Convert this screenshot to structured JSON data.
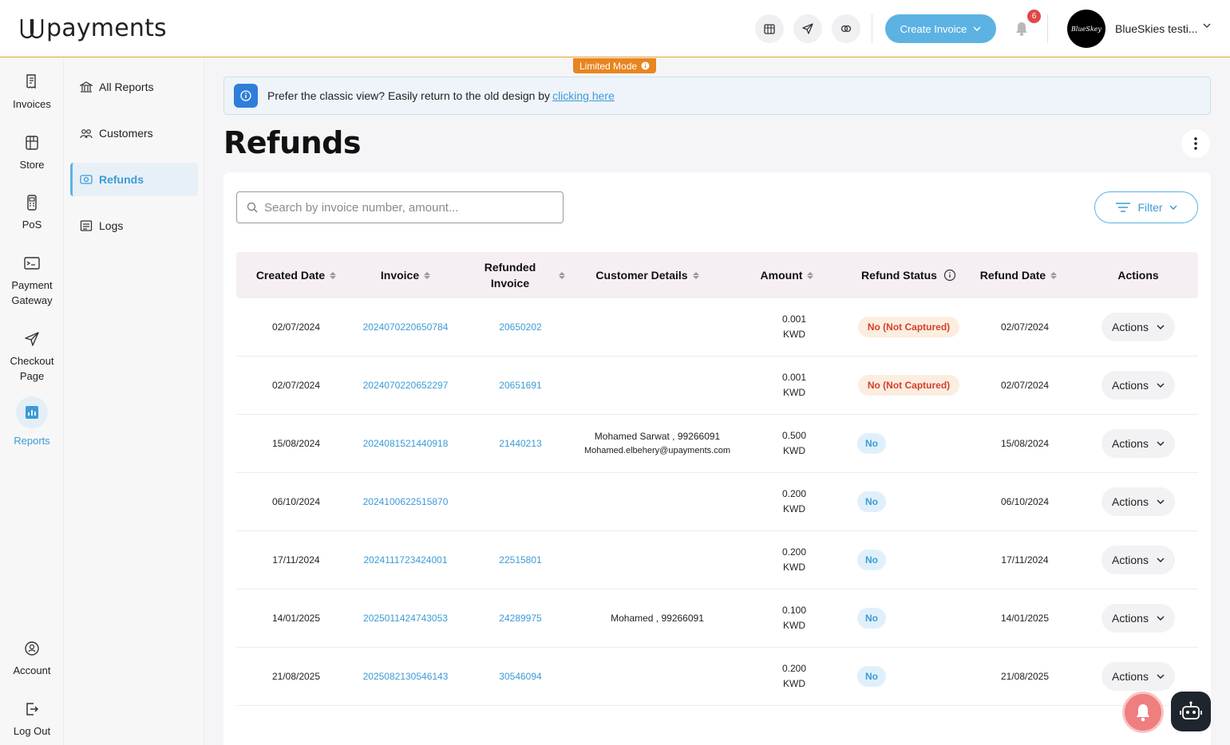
{
  "header": {
    "logo_text": "payments",
    "create_invoice_label": "Create Invoice",
    "notification_count": "6",
    "avatar_text": "BlueSkey",
    "user_name": "BlueSkies testi...",
    "accent": "#5cb2e3"
  },
  "rail": {
    "items": [
      {
        "label": "Invoices",
        "icon": "invoice-icon"
      },
      {
        "label": "Store",
        "icon": "store-icon"
      },
      {
        "label": "PoS",
        "icon": "pos-icon"
      },
      {
        "label": "Payment Gateway",
        "icon": "gateway-icon"
      },
      {
        "label": "Checkout Page",
        "icon": "send-icon"
      },
      {
        "label": "Reports",
        "icon": "chart-icon"
      },
      {
        "label": "Account",
        "icon": "account-icon"
      },
      {
        "label": "Log Out",
        "icon": "logout-icon"
      }
    ]
  },
  "subnav": {
    "items": [
      {
        "label": "All Reports"
      },
      {
        "label": "Customers"
      },
      {
        "label": "Refunds"
      },
      {
        "label": "Logs"
      }
    ]
  },
  "main": {
    "limited_mode": "Limited Mode",
    "notice_text": "Prefer the classic view? Easily return to the old design by",
    "notice_link": "clicking here",
    "page_title": "Refunds",
    "search_placeholder": "Search by invoice number, amount...",
    "filter_label": "Filter"
  },
  "table": {
    "columns": [
      "Created Date",
      "Invoice",
      "Refunded Invoice",
      "Customer Details",
      "Amount",
      "Refund Status",
      "Refund Date",
      "Actions"
    ],
    "rows": [
      {
        "created": "02/07/2024",
        "invoice": "2024070220650784",
        "refunded": "20650202",
        "cust_name": "",
        "cust_email": "",
        "amount": "0.001",
        "currency": "KWD",
        "status": "No (Not Captured)",
        "refund_date": "02/07/2024",
        "action": "Actions"
      },
      {
        "created": "02/07/2024",
        "invoice": "2024070220652297",
        "refunded": "20651691",
        "cust_name": "",
        "cust_email": "",
        "amount": "0.001",
        "currency": "KWD",
        "status": "No (Not Captured)",
        "refund_date": "02/07/2024",
        "action": "Actions"
      },
      {
        "created": "15/08/2024",
        "invoice": "2024081521440918",
        "refunded": "21440213",
        "cust_name": "Mohamed Sarwat , 99266091",
        "cust_email": "Mohamed.elbehery@upayments.com",
        "amount": "0.500",
        "currency": "KWD",
        "status": "No",
        "refund_date": "15/08/2024",
        "action": "Actions"
      },
      {
        "created": "06/10/2024",
        "invoice": "2024100622515870",
        "refunded": "",
        "cust_name": "",
        "cust_email": "",
        "amount": "0.200",
        "currency": "KWD",
        "status": "No",
        "refund_date": "06/10/2024",
        "action": "Actions"
      },
      {
        "created": "17/11/2024",
        "invoice": "2024111723424001",
        "refunded": "22515801",
        "cust_name": "",
        "cust_email": "",
        "amount": "0.200",
        "currency": "KWD",
        "status": "No",
        "refund_date": "17/11/2024",
        "action": "Actions"
      },
      {
        "created": "14/01/2025",
        "invoice": "2025011424743053",
        "refunded": "24289975",
        "cust_name": "Mohamed , 99266091",
        "cust_email": "",
        "amount": "0.100",
        "currency": "KWD",
        "status": "No",
        "refund_date": "14/01/2025",
        "action": "Actions"
      },
      {
        "created": "21/08/2025",
        "invoice": "2025082130546143",
        "refunded": "30546094",
        "cust_name": "",
        "cust_email": "",
        "amount": "0.200",
        "currency": "KWD",
        "status": "No",
        "refund_date": "21/08/2025",
        "action": "Actions"
      }
    ]
  }
}
